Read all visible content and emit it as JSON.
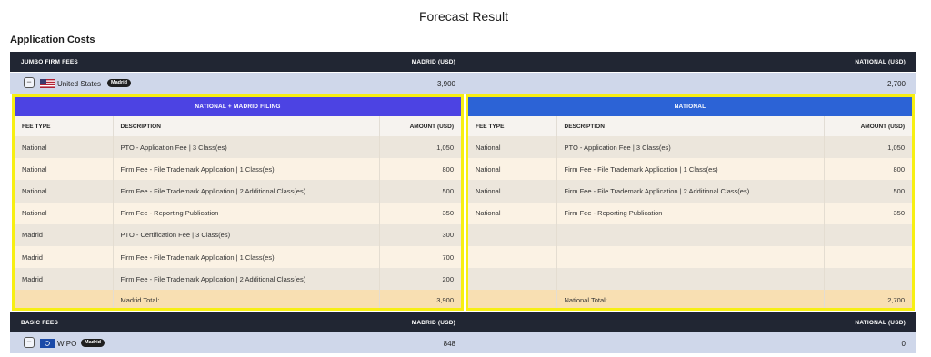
{
  "page_title": "Forecast Result",
  "section_title": "Application Costs",
  "jumbo": {
    "label": "JUMBO FIRM FEES",
    "madrid_col": "MADRID (USD)",
    "national_col": "NATIONAL (USD)",
    "country": "United States",
    "badge": "Madrid",
    "madrid_value": "3,900",
    "national_value": "2,700",
    "expand_symbol": "−"
  },
  "left_panel": {
    "title": "NATIONAL + MADRID FILING",
    "headers": [
      "FEE TYPE",
      "DESCRIPTION",
      "AMOUNT (USD)"
    ],
    "rows": [
      {
        "type": "National",
        "desc": "PTO - Application Fee | 3 Class(es)",
        "amount": "1,050"
      },
      {
        "type": "National",
        "desc": "Firm Fee - File Trademark Application | 1 Class(es)",
        "amount": "800"
      },
      {
        "type": "National",
        "desc": "Firm Fee - File Trademark Application | 2 Additional Class(es)",
        "amount": "500"
      },
      {
        "type": "National",
        "desc": "Firm Fee - Reporting Publication",
        "amount": "350"
      },
      {
        "type": "Madrid",
        "desc": "PTO - Certification Fee | 3 Class(es)",
        "amount": "300"
      },
      {
        "type": "Madrid",
        "desc": "Firm Fee - File Trademark Application | 1 Class(es)",
        "amount": "700"
      },
      {
        "type": "Madrid",
        "desc": "Firm Fee - File Trademark Application | 2 Additional Class(es)",
        "amount": "200"
      }
    ],
    "total_label": "Madrid Total:",
    "total_value": "3,900"
  },
  "right_panel": {
    "title": "NATIONAL",
    "headers": [
      "FEE TYPE",
      "DESCRIPTION",
      "AMOUNT (USD)"
    ],
    "rows": [
      {
        "type": "National",
        "desc": "PTO - Application Fee | 3 Class(es)",
        "amount": "1,050"
      },
      {
        "type": "National",
        "desc": "Firm Fee - File Trademark Application | 1 Class(es)",
        "amount": "800"
      },
      {
        "type": "National",
        "desc": "Firm Fee - File Trademark Application | 2 Additional Class(es)",
        "amount": "500"
      },
      {
        "type": "National",
        "desc": "Firm Fee - Reporting Publication",
        "amount": "350"
      },
      {
        "type": "",
        "desc": "",
        "amount": ""
      },
      {
        "type": "",
        "desc": "",
        "amount": ""
      },
      {
        "type": "",
        "desc": "",
        "amount": ""
      }
    ],
    "total_label": "National Total:",
    "total_value": "2,700"
  },
  "basic": {
    "label": "BASIC FEES",
    "madrid_col": "MADRID (USD)",
    "national_col": "NATIONAL (USD)",
    "country": "WIPO",
    "badge": "Madrid",
    "madrid_value": "848",
    "national_value": "0",
    "expand_symbol": "−"
  },
  "icons": {
    "us_flag": "us-flag-icon",
    "wipo_flag": "wipo-flag-icon",
    "expand": "collapse-icon"
  },
  "colors": {
    "header_dark": "#212633",
    "row_blue": "#cfd7ea",
    "madrid_panel_head": "#4c43e3",
    "national_panel_head": "#2c63d6",
    "highlight_border": "#f7ef12",
    "total_row": "#f8dfb2"
  }
}
